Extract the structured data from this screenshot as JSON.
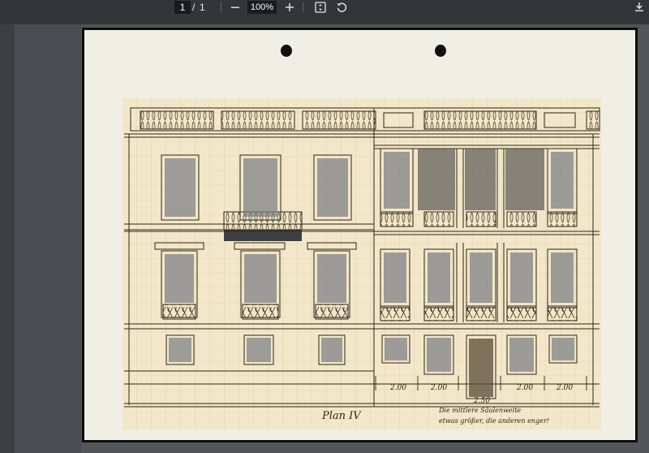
{
  "toolbar": {
    "current_page": "1",
    "page_separator": "/",
    "total_pages": "1",
    "zoom_level": "100%",
    "icons": [
      "zoom-out-icon",
      "zoom-in-icon",
      "fit-page-icon",
      "rotate-icon",
      "download-icon"
    ]
  },
  "document": {
    "plan_label": "Plan IV",
    "dimensions": [
      "2.00",
      "2.00",
      "2.50",
      "2.00",
      "2.00"
    ],
    "note_line1": "Die mittlere Säulenweite",
    "note_line2": "etwas größer, die anderen enger!"
  },
  "colors": {
    "toolbar_bg": "#323639",
    "viewer_bg": "#525659",
    "paper": "#efefe6",
    "drawing_sheet": "#f2e7c8",
    "ink": "#2d2418",
    "window_wash": "#7b7f86"
  }
}
